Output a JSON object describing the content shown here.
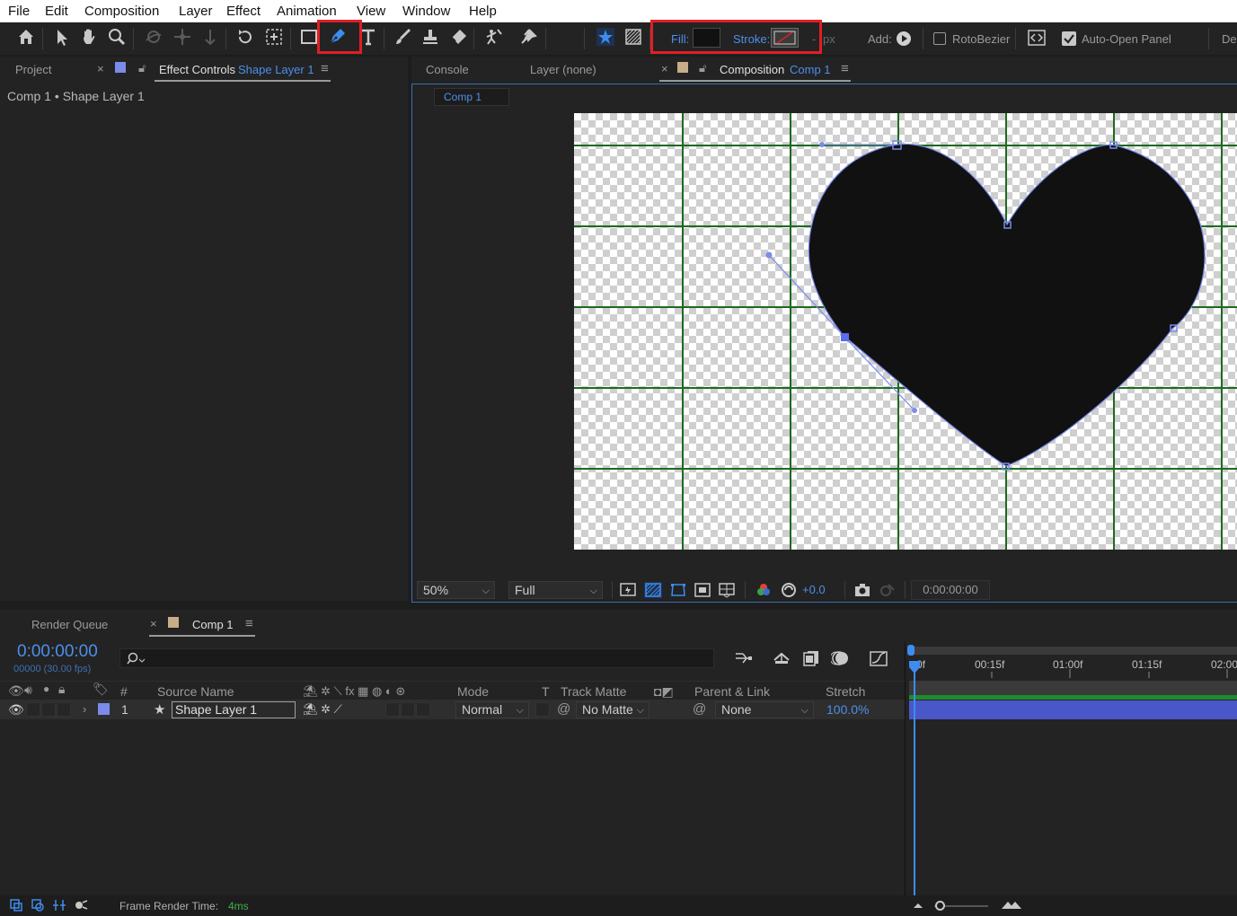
{
  "menu": [
    "File",
    "Edit",
    "Composition",
    "Layer",
    "Effect",
    "Animation",
    "View",
    "Window",
    "Help"
  ],
  "toolbar": {
    "fill_label": "Fill:",
    "stroke_label": "Stroke:",
    "stroke_width_unit": "px",
    "stroke_width_dash": "-",
    "add_label": "Add:",
    "rotobezier_label": "RotoBezier",
    "auto_open_label": "Auto-Open Panel",
    "truncated_label": "De",
    "active_tool": "pen-tool",
    "fill_color": "#111111",
    "stroke_color": "none"
  },
  "left_panel": {
    "tab_project": "Project",
    "tab_effect_controls": "Effect Controls",
    "tab_effect_controls_layer": "Shape Layer 1",
    "breadcrumb": "Comp 1 • Shape Layer 1"
  },
  "viewer": {
    "tab_console": "Console",
    "tab_layer": "Layer (none)",
    "tab_composition": "Composition",
    "tab_composition_name": "Comp 1",
    "subtab": "Comp 1",
    "zoom": "50%",
    "resolution": "Full",
    "exposure": "+0.0",
    "timecode": "0:00:00:00"
  },
  "timeline": {
    "tab_render_queue": "Render Queue",
    "tab_comp": "Comp 1",
    "current_time": "0:00:00:00",
    "frame_info": "00000 (30.00 fps)",
    "search_placeholder": "",
    "col_hash": "#",
    "col_source_name": "Source Name",
    "col_mode": "Mode",
    "col_t": "T",
    "col_track_matte": "Track Matte",
    "col_parent": "Parent & Link",
    "col_stretch": "Stretch",
    "ruler": [
      "0f",
      "00:15f",
      "01:00f",
      "01:15f",
      "02:00"
    ],
    "layers": [
      {
        "index": "1",
        "name": "Shape Layer 1",
        "mode": "Normal",
        "track_matte": "No Matte",
        "parent": "None",
        "stretch": "100.0%",
        "label_color": "#7a8bea"
      }
    ]
  },
  "status": {
    "frame_render_label": "Frame Render Time:",
    "frame_render_value": "4ms"
  },
  "colors": {
    "accent": "#4d8fea",
    "highlight": "#e01e26",
    "layer_bar": "#4a57c8",
    "grid": "#1e6a1e",
    "shape_fill": "#111111"
  }
}
